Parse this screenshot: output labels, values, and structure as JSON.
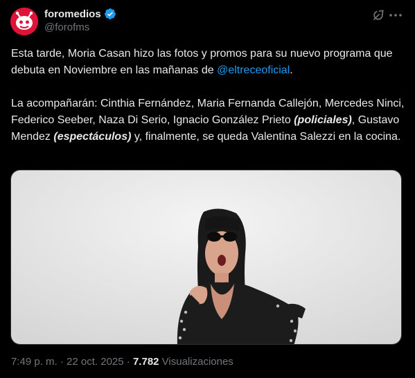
{
  "author": {
    "name": "foromedios",
    "handle": "@forofms",
    "avatar_color": "#e0123a",
    "verified": true
  },
  "tweet": {
    "paragraph1_text": "Esta tarde, Moria Casan hizo las fotos y promos para su nuevo programa que debuta en Noviembre en las mañanas de ",
    "mention": "@eltreceoficial",
    "paragraph1_end": ".",
    "paragraph2_a": "La acompañarán: Cinthia Fernández, Maria Fernanda Callejón, Mercedes Ninci, Federico Seeber, Naza Di Serio, Ignacio González Prieto ",
    "paragraph2_b": "(policiales)",
    "paragraph2_c": ", Gustavo Mendez ",
    "paragraph2_d": "(espectáculos)",
    "paragraph2_e": " y, finalmente, se queda Valentina Salezzi en la cocina."
  },
  "meta": {
    "time": "7:49 p. m.",
    "separator": " · ",
    "date": "22 oct. 2025",
    "views_count": "7.782",
    "views_label": " Visualizaciones"
  },
  "icons": {
    "verified": "verified-badge-icon",
    "grok": "grok-icon",
    "more": "more-dots-icon"
  },
  "colors": {
    "background": "#000000",
    "text": "#e7e9ea",
    "muted": "#71767b",
    "link": "#1d9bf0",
    "verified": "#1d9bf0"
  }
}
